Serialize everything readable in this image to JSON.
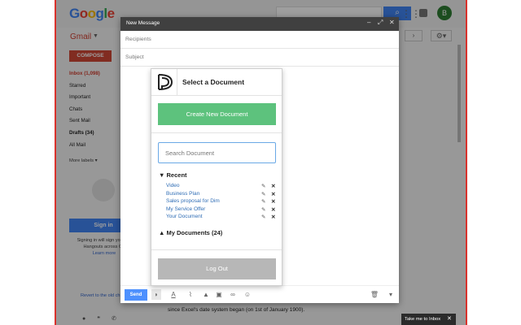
{
  "gmail": {
    "logo_text": [
      "G",
      "o",
      "o",
      "g",
      "l",
      "e"
    ],
    "label": "Gmail",
    "compose": "COMPOSE",
    "nav": [
      "Inbox (1,098)",
      "Starred",
      "Important",
      "Chats",
      "Sent Mail",
      "Drafts (34)",
      "All Mail"
    ],
    "more_labels": "More labels ▾",
    "signin": "Sign in",
    "signin_text": "Signing in will sign you into Hangouts across Go",
    "learn_more": "Learn more",
    "revert": "Revert to the old ch",
    "avatar_letter": "B",
    "body_text": "since Excel's date system began (on 1st of January 1900)."
  },
  "compose": {
    "title": "New Message",
    "recipients_placeholder": "Recipients",
    "subject_placeholder": "Subject",
    "send_label": "Send"
  },
  "doc_popup": {
    "title": "Select a Document",
    "create_button": "Create New Document",
    "search_placeholder": "Search Document",
    "recent_label": "Recent",
    "recent_items": [
      "Video",
      "Business Plan",
      "Sales proposal for Dim",
      "My Service Offer",
      "Your Document"
    ],
    "my_documents_label": "My Documents (24)",
    "logout": "Log Out"
  },
  "banner": {
    "text": "Take me to Inbox"
  },
  "colors": {
    "create_green": "#5dc27d",
    "logout_gray": "#b7b7b7",
    "send_blue": "#4d90fe",
    "link_blue": "#2f6db5",
    "frame_red": "#d9322c"
  }
}
